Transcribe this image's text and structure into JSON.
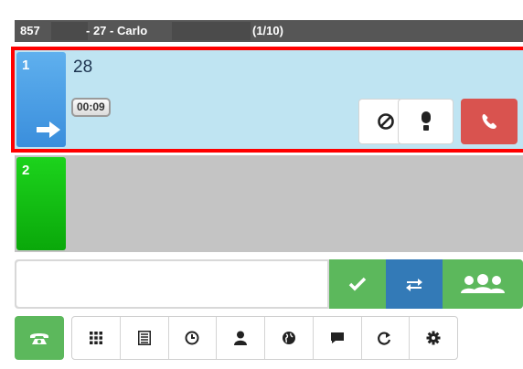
{
  "header": {
    "extension": "857",
    "caller_info": "- 27 - Carlo",
    "count": "(1/10)"
  },
  "lines": [
    {
      "number": "1",
      "caller": "28",
      "timer": "00:09",
      "state": "active"
    },
    {
      "number": "2",
      "state": "idle"
    }
  ],
  "dial": {
    "value": "",
    "placeholder": ""
  },
  "colors": {
    "active_line": "#3a8edc",
    "idle_line": "#0aa80a",
    "hangup": "#d9534f",
    "ok": "#5cb85c",
    "transfer": "#337ab7",
    "highlight_border": "#ff0000"
  },
  "icons": {
    "line1_actions": [
      "block-icon",
      "mute-icon",
      "hangup-icon"
    ],
    "dial_actions": [
      "check-icon",
      "transfer-icon",
      "conference-icon"
    ],
    "toolbar": [
      "phone-icon",
      "dialpad-icon",
      "list-icon",
      "history-icon",
      "contact-icon",
      "globe-icon",
      "chat-icon",
      "forward-icon",
      "settings-icon"
    ]
  }
}
